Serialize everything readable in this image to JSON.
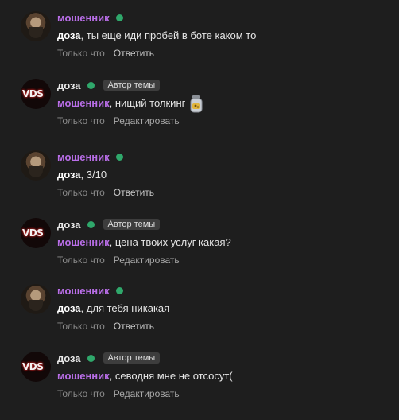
{
  "comments": [
    {
      "author": "мошенник",
      "mention": "доза",
      "text": ", ты еще иди пробей в боте каком то",
      "timestamp": "Только что",
      "action": "Ответить"
    },
    {
      "author": "доза",
      "badge": "Автор темы",
      "avatar_text": "VDS",
      "mention": "мошенник",
      "text": ", нищий толкинг",
      "emoji_icon": "jar-emoji",
      "timestamp": "Только что",
      "action": "Редактировать"
    },
    {
      "author": "мошенник",
      "mention": "доза",
      "text": ", 3/10",
      "timestamp": "Только что",
      "action": "Ответить"
    },
    {
      "author": "доза",
      "badge": "Автор темы",
      "avatar_text": "VDS",
      "mention": "мошенник",
      "text": ", цена твоих услуг какая?",
      "timestamp": "Только что",
      "action": "Редактировать"
    },
    {
      "author": "мошенник",
      "mention": "доза",
      "text": ", для тебя никакая",
      "timestamp": "Только что",
      "action": "Ответить"
    },
    {
      "author": "доза",
      "badge": "Автор темы",
      "avatar_text": "VDS",
      "mention": "мошенник",
      "text": ", севодня мне не отсосут(",
      "timestamp": "Только что",
      "action": "Редактировать"
    }
  ],
  "colors": {
    "background": "#1e1e1e",
    "username_accent": "#b96ee8",
    "online_indicator": "#2fa86b",
    "badge_bg": "#3d3d3d",
    "meta_text": "#8b8b8b"
  }
}
